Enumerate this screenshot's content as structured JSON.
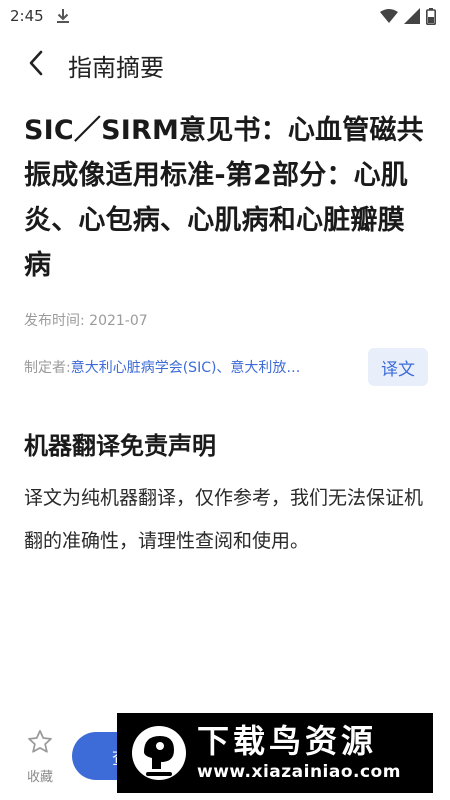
{
  "status_bar": {
    "time": "2:45",
    "icons": [
      "download-icon",
      "wifi-icon",
      "signal-icon",
      "battery-icon"
    ]
  },
  "app_bar": {
    "back_icon": "chevron-left-icon",
    "title": "指南摘要"
  },
  "document": {
    "title": "SIC／SIRM意见书：心血管磁共振成像适用标准-第2部分：心肌炎、心包病、心肌病和心脏瓣膜病",
    "publish_date": "发布时间: 2021-07",
    "author_prefix": "制定者:",
    "author_names": "意大利心脏病学会(SIC)、意大利放…",
    "translate_label": "译文"
  },
  "disclaimer": {
    "title": "机器翻译免责声明",
    "body": "译文为纯机器翻译，仅作参考，我们无法保证机翻的准确性，请理性查阅和使用。"
  },
  "bottom_bar": {
    "favorite_label": "收藏",
    "favorite_icon": "star-icon",
    "primary_button_label": "查"
  },
  "watermark": {
    "name": "下载鸟资源",
    "url": "www.xiazainiao.com"
  },
  "colors": {
    "accent": "#3d6cd8",
    "accent_light": "#e9eefb",
    "muted_text": "#9b9b9b",
    "watermark_bg": "#000000"
  }
}
